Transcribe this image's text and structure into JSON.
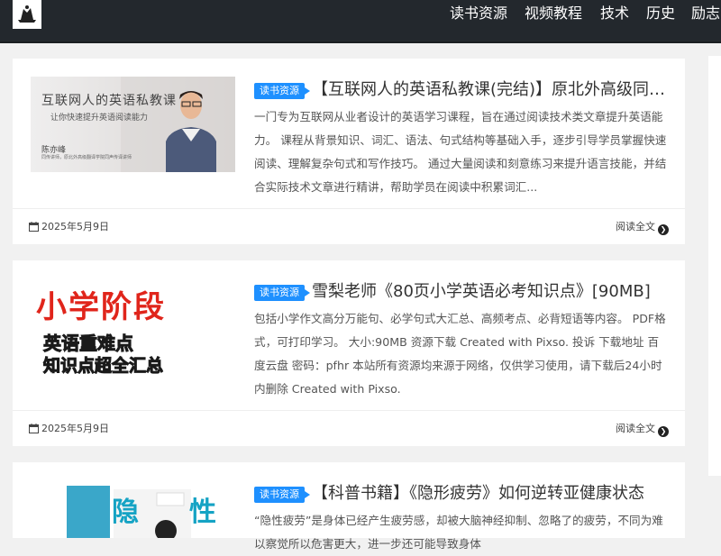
{
  "nav": {
    "items": [
      "读书资源",
      "视频教程",
      "技术",
      "历史",
      "励志"
    ]
  },
  "posts": [
    {
      "category": "读书资源",
      "title": "【互联网人的英语私教课(完结)】原北外高级同传讲师陈亦峰",
      "excerpt": "一门专为互联网从业者设计的英语学习课程，旨在通过阅读技术类文章提升英语能力。 课程从背景知识、词汇、语法、句式结构等基础入手，逐步引导学员掌握快速阅读、理解复杂句式和写作技巧。 通过大量阅读和刻意练习来提升语言技能，并结合实际技术文章进行精讲，帮助学员在阅读中积累词汇...",
      "date": "2025年5月9日",
      "read_more": "阅读全文",
      "thumb": {
        "line1": "互联网人的英语私教课",
        "line2": "让你快速提升英语阅读能力",
        "name": "陈亦峰",
        "desc": "同传讲师，原北外高级翻译学院同声传译讲师"
      }
    },
    {
      "category": "读书资源",
      "title": "雪梨老师《80页小学英语必考知识点》[90MB]",
      "excerpt": "包括小学作文高分万能句、必学句式大汇总、高频考点、必背短语等内容。 PDF格式，可打印学习。 大小:90MB 资源下载 Created with Pixso. 投诉 下载地址 百度云盘 密码：pfhr 本站所有资源均来源于网络，仅供学习使用，请下载后24小时内删除 Created with Pixso.",
      "date": "2025年5月9日",
      "read_more": "阅读全文",
      "thumb": {
        "line1": "小学阶段",
        "line2": "英语重难点",
        "line3": "知识点超全汇总"
      }
    },
    {
      "category": "读书资源",
      "title": "【科普书籍】《隐形疲劳》如何逆转亚健康状态",
      "excerpt": "“隐性疲劳”是身体已经产生疲劳感，却被大脑神经抑制、忽略了的疲劳，不同为难以察觉所以危害更大，进一步还可能导致身体",
      "date": "",
      "read_more": "",
      "thumb": {
        "line1": "隐",
        "line2": "性"
      }
    }
  ],
  "colors": {
    "topbar": "#23282d",
    "badge": "#1e90ff",
    "page_bg": "#f1f1f1"
  }
}
